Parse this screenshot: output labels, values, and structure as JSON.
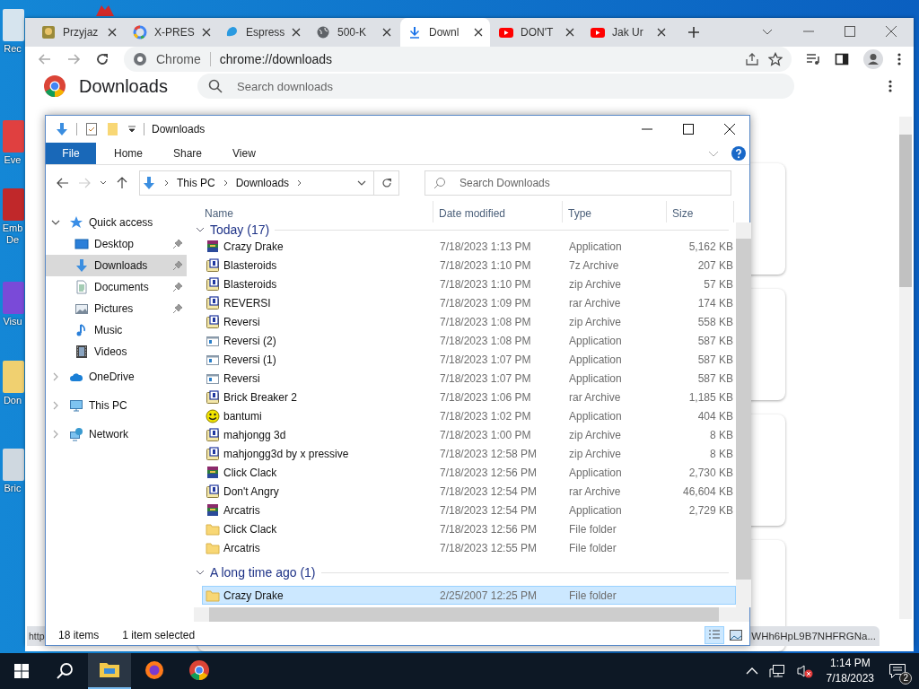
{
  "desktop_icons": [
    {
      "label": "Rec",
      "kind": "bin"
    },
    {
      "label": "Eve",
      "kind": "shortcut"
    },
    {
      "label": "Emb De",
      "kind": "app"
    },
    {
      "label": "Visu",
      "kind": "app2"
    },
    {
      "label": "Don",
      "kind": "folder"
    },
    {
      "label": "Bric",
      "kind": "app3"
    }
  ],
  "chrome": {
    "tabs": [
      {
        "title": "Przyjaz",
        "kind": "game",
        "selected": false
      },
      {
        "title": "X-PRES",
        "kind": "google",
        "selected": false
      },
      {
        "title": "Espress",
        "kind": "bird",
        "selected": false
      },
      {
        "title": "500-K",
        "kind": "globe",
        "selected": false
      },
      {
        "title": "Downl",
        "kind": "download",
        "selected": true
      },
      {
        "title": "DON'T",
        "kind": "video",
        "selected": false
      },
      {
        "title": "Jak Ur",
        "kind": "video",
        "selected": false
      }
    ],
    "site_label": "Chrome",
    "url": "chrome://downloads",
    "page": {
      "title": "Downloads",
      "search_placeholder": "Search downloads"
    },
    "status_url_start": "http",
    "status_url_end": "WHh6HpL9B7NHFRGNa..."
  },
  "explorer": {
    "title": "Downloads",
    "ribbon_tabs": [
      {
        "label": "File",
        "selected": true
      },
      {
        "label": "Home",
        "selected": false
      },
      {
        "label": "Share",
        "selected": false
      },
      {
        "label": "View",
        "selected": false
      }
    ],
    "breadcrumb": [
      "This PC",
      "Downloads"
    ],
    "search_placeholder": "Search Downloads",
    "nav": [
      {
        "label": "Quick access",
        "kind": "star",
        "expanded": true,
        "selected": false,
        "children": [
          {
            "label": "Desktop",
            "kind": "desktop",
            "pinned": true,
            "selected": false
          },
          {
            "label": "Downloads",
            "kind": "downloads",
            "pinned": true,
            "selected": true
          },
          {
            "label": "Documents",
            "kind": "documents",
            "pinned": true,
            "selected": false
          },
          {
            "label": "Pictures",
            "kind": "pictures",
            "pinned": true,
            "selected": false
          },
          {
            "label": "Music",
            "kind": "music",
            "pinned": false,
            "selected": false
          },
          {
            "label": "Videos",
            "kind": "videos",
            "pinned": false,
            "selected": false
          }
        ]
      },
      {
        "label": "OneDrive",
        "kind": "cloud",
        "expanded": false,
        "selected": false
      },
      {
        "label": "This PC",
        "kind": "pc",
        "expanded": false,
        "selected": false
      },
      {
        "label": "Network",
        "kind": "network",
        "expanded": false,
        "selected": false
      }
    ],
    "columns": [
      "Name",
      "Date modified",
      "Type",
      "Size"
    ],
    "groups": [
      {
        "title": "Today (17)",
        "expanded": true,
        "rows": [
          {
            "name": "Crazy Drake",
            "date": "7/18/2023 1:13 PM",
            "type": "Application",
            "size": "5,162 KB",
            "kind": "installer",
            "selected": false
          },
          {
            "name": "Blasteroids",
            "date": "7/18/2023 1:10 PM",
            "type": "7z Archive",
            "size": "207 KB",
            "kind": "archive",
            "selected": false
          },
          {
            "name": "Blasteroids",
            "date": "7/18/2023 1:10 PM",
            "type": "zip Archive",
            "size": "57 KB",
            "kind": "archive",
            "selected": false
          },
          {
            "name": "REVERSI",
            "date": "7/18/2023 1:09 PM",
            "type": "rar Archive",
            "size": "174 KB",
            "kind": "archive",
            "selected": false
          },
          {
            "name": "Reversi",
            "date": "7/18/2023 1:08 PM",
            "type": "zip Archive",
            "size": "558 KB",
            "kind": "archive",
            "selected": false
          },
          {
            "name": "Reversi (2)",
            "date": "7/18/2023 1:08 PM",
            "type": "Application",
            "size": "587 KB",
            "kind": "program",
            "selected": false
          },
          {
            "name": "Reversi (1)",
            "date": "7/18/2023 1:07 PM",
            "type": "Application",
            "size": "587 KB",
            "kind": "program",
            "selected": false
          },
          {
            "name": "Reversi",
            "date": "7/18/2023 1:07 PM",
            "type": "Application",
            "size": "587 KB",
            "kind": "program",
            "selected": false
          },
          {
            "name": "Brick Breaker 2",
            "date": "7/18/2023 1:06 PM",
            "type": "rar Archive",
            "size": "1,185 KB",
            "kind": "archive",
            "selected": false
          },
          {
            "name": "bantumi",
            "date": "7/18/2023 1:02 PM",
            "type": "Application",
            "size": "404 KB",
            "kind": "smiley",
            "selected": false
          },
          {
            "name": "mahjongg 3d",
            "date": "7/18/2023 1:00 PM",
            "type": "zip Archive",
            "size": "8 KB",
            "kind": "archive",
            "selected": false
          },
          {
            "name": "mahjongg3d by x pressive",
            "date": "7/18/2023 12:58 PM",
            "type": "zip Archive",
            "size": "8 KB",
            "kind": "archive",
            "selected": false
          },
          {
            "name": "Click Clack",
            "date": "7/18/2023 12:56 PM",
            "type": "Application",
            "size": "2,730 KB",
            "kind": "installer",
            "selected": false
          },
          {
            "name": "Don't Angry",
            "date": "7/18/2023 12:54 PM",
            "type": "rar Archive",
            "size": "46,604 KB",
            "kind": "archive",
            "selected": false
          },
          {
            "name": "Arcatris",
            "date": "7/18/2023 12:54 PM",
            "type": "Application",
            "size": "2,729 KB",
            "kind": "installer",
            "selected": false
          },
          {
            "name": "Click Clack",
            "date": "7/18/2023 12:56 PM",
            "type": "File folder",
            "kind": "folder",
            "selected": false
          },
          {
            "name": "Arcatris",
            "date": "7/18/2023 12:55 PM",
            "type": "File folder",
            "kind": "folder",
            "selected": false
          }
        ]
      },
      {
        "title": "A long time ago (1)",
        "expanded": true,
        "rows": [
          {
            "name": "Crazy Drake",
            "date": "2/25/2007 12:25 PM",
            "type": "File folder",
            "kind": "folder",
            "selected": true
          }
        ]
      }
    ],
    "status": {
      "item_count": "18 items",
      "selection": "1 item selected"
    },
    "view_modes": [
      {
        "kind": "details",
        "selected": true
      },
      {
        "kind": "thumbnails",
        "selected": false
      }
    ]
  },
  "taskbar": {
    "apps": [
      {
        "kind": "explorer",
        "active": true
      },
      {
        "kind": "firefox",
        "active": false
      },
      {
        "kind": "chrome",
        "active": false
      }
    ],
    "time": "1:14 PM",
    "date": "7/18/2023",
    "notification_count": "2"
  }
}
